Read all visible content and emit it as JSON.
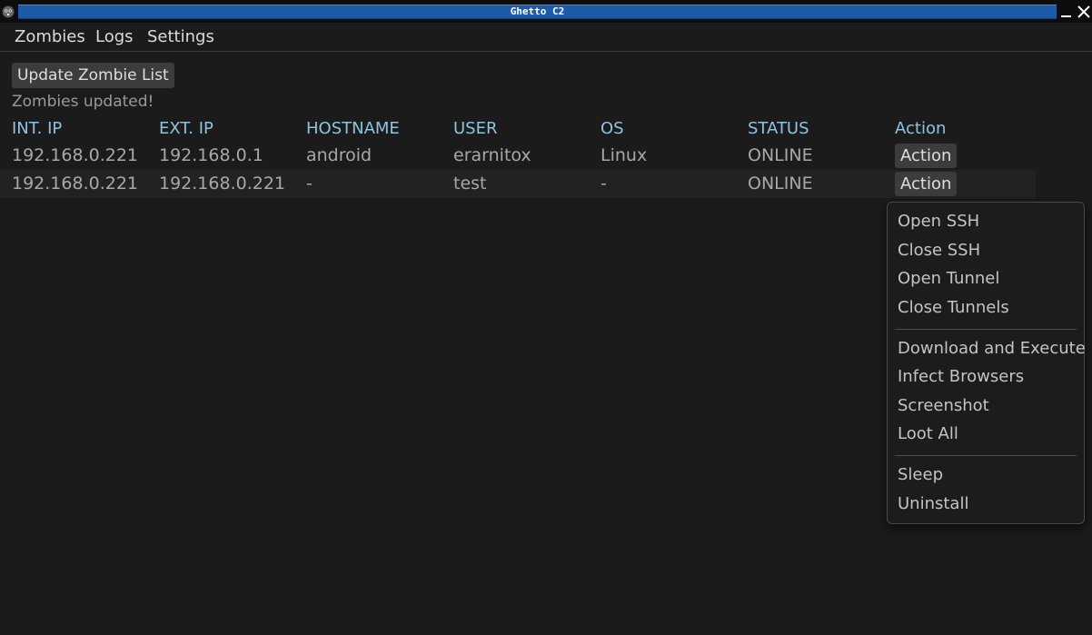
{
  "window": {
    "title": "Ghetto C2",
    "icons": {
      "app": "gopher-icon",
      "minimize": "minimize-icon",
      "close": "close-icon"
    },
    "title_bar_color": "#1e5aa8"
  },
  "menu": {
    "items": [
      "Zombies",
      "Logs",
      "Settings"
    ]
  },
  "toolbar": {
    "update_label": "Update Zombie List",
    "status_message": "Zombies updated!"
  },
  "table": {
    "headers": [
      "INT. IP",
      "EXT. IP",
      "HOSTNAME",
      "USER",
      "OS",
      "STATUS",
      "Action"
    ],
    "rows": [
      {
        "int_ip": "192.168.0.221",
        "ext_ip": "192.168.0.1",
        "hostname": "android",
        "user": "erarnitox",
        "os": "Linux",
        "status": "ONLINE",
        "action": "Action"
      },
      {
        "int_ip": "192.168.0.221",
        "ext_ip": "192.168.0.221",
        "hostname": "-",
        "user": "test",
        "os": "-",
        "status": "ONLINE",
        "action": "Action"
      }
    ],
    "header_color": "#8fc3e0"
  },
  "action_menu": {
    "groups": [
      [
        "Open SSH",
        "Close SSH",
        "Open Tunnel",
        "Close Tunnels"
      ],
      [
        "Download and Execute",
        "Infect Browsers",
        "Screenshot",
        "Loot All"
      ],
      [
        "Sleep",
        "Uninstall"
      ]
    ]
  }
}
